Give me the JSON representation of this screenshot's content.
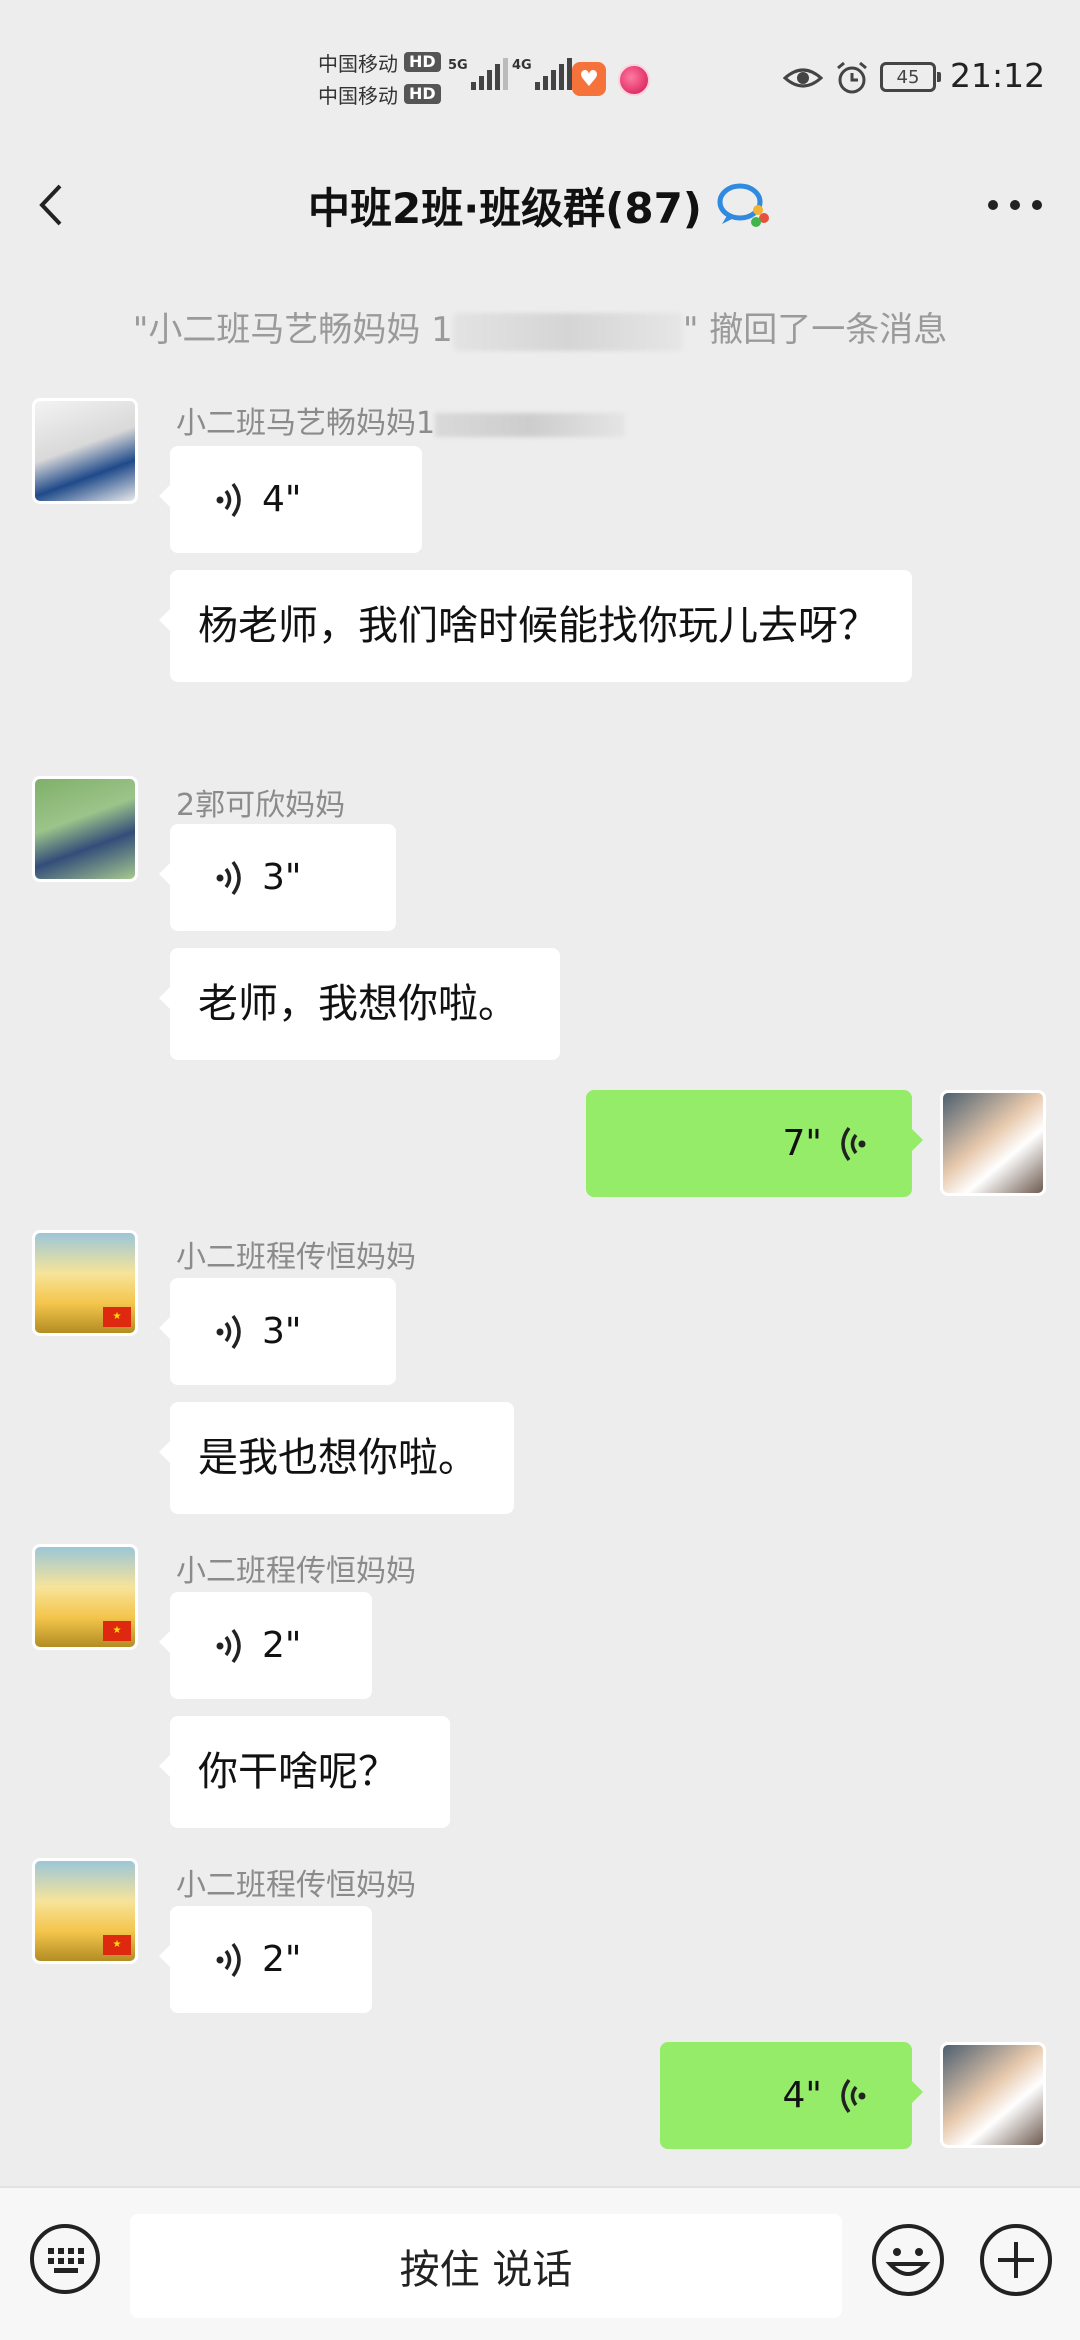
{
  "status_bar": {
    "carrier_1": "中国移动",
    "carrier_2": "中国移动",
    "hd_label": "HD",
    "net_1": "5G",
    "net_2": "4G",
    "battery": "45",
    "time": "21:12"
  },
  "header": {
    "title": "中班2班·班级群(87)"
  },
  "recall_notice": {
    "prefix": "\"小二班马艺畅妈妈 1",
    "suffix": "\" 撤回了一条消息"
  },
  "messages": [
    {
      "sender": "小二班马艺畅妈妈1",
      "voice_duration": "4\"",
      "text": "杨老师，我们啥时候能找你玩儿去呀？"
    },
    {
      "sender": "2郭可欣妈妈",
      "voice_duration": "3\"",
      "text": "老师，我想你啦。"
    },
    {
      "sender": "me",
      "voice_duration": "7\""
    },
    {
      "sender": "小二班程传恒妈妈",
      "voice_duration": "3\"",
      "text": "是我也想你啦。"
    },
    {
      "sender": "小二班程传恒妈妈",
      "voice_duration": "2\"",
      "text": "你干啥呢？"
    },
    {
      "sender": "小二班程传恒妈妈",
      "voice_duration": "2\""
    },
    {
      "sender": "me",
      "voice_duration": "4\""
    }
  ],
  "input_bar": {
    "hold_to_talk": "按住 说话"
  }
}
